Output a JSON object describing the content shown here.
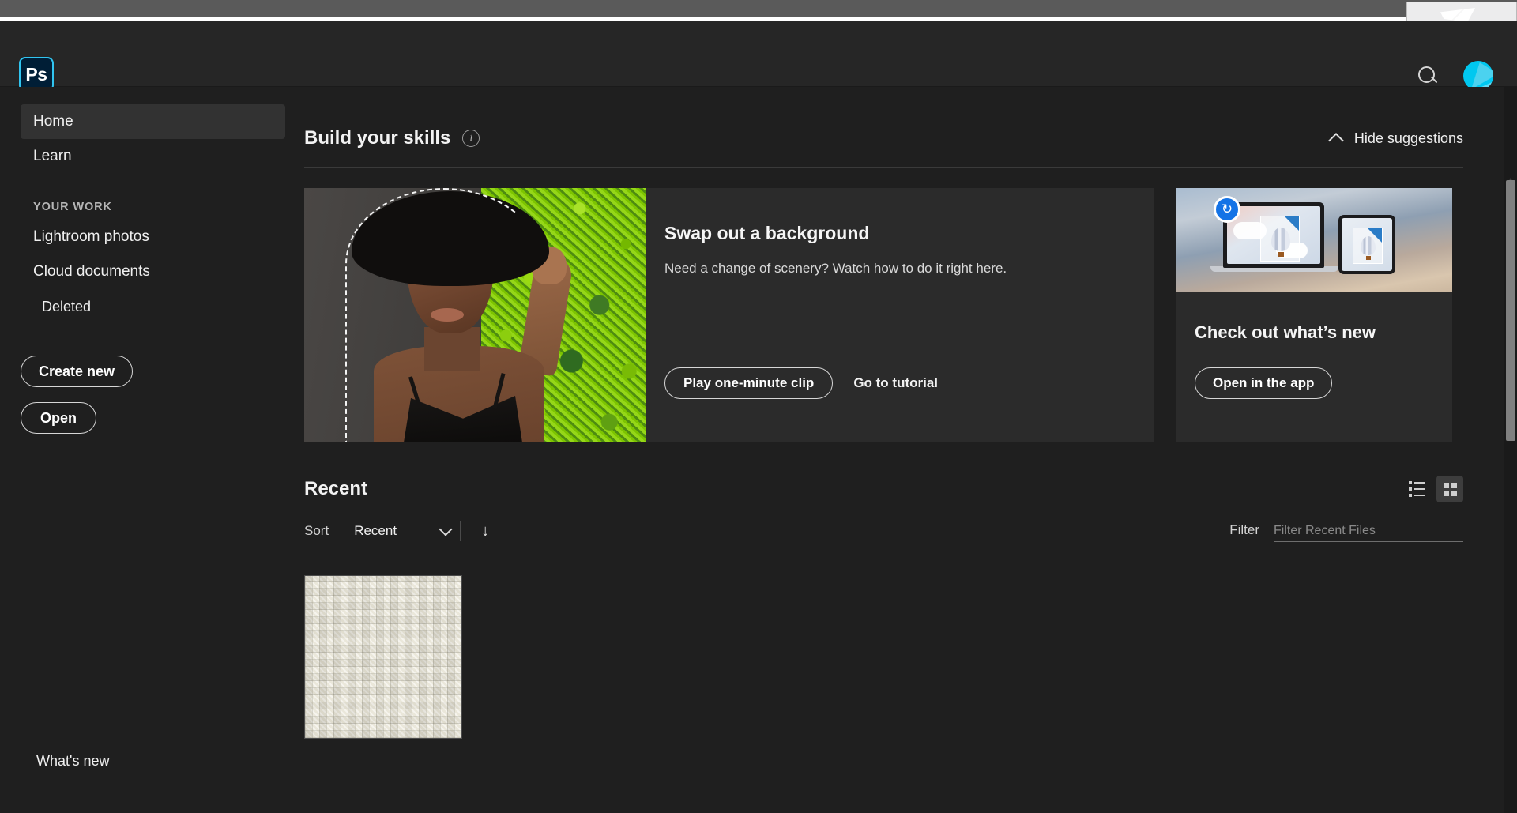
{
  "window": {
    "title_bar_tab": ""
  },
  "appbar": {
    "logo_text": "Ps",
    "search_icon": "search-icon",
    "avatar_icon": "user-avatar"
  },
  "sidebar": {
    "items": [
      {
        "label": "Home",
        "active": true
      },
      {
        "label": "Learn",
        "active": false
      }
    ],
    "group_title": "YOUR WORK",
    "work_items": [
      {
        "label": "Lightroom photos",
        "sub": false
      },
      {
        "label": "Cloud documents",
        "sub": false
      },
      {
        "label": "Deleted",
        "sub": true
      }
    ],
    "create_new_label": "Create new",
    "open_label": "Open",
    "whats_new_label": "What's new"
  },
  "skills": {
    "title": "Build your skills",
    "info_icon": "info-icon",
    "hide_label": "Hide suggestions",
    "chevron_icon": "chevron-up-icon"
  },
  "tutorial_card": {
    "title": "Swap out a background",
    "description": "Need a change of scenery? Watch how to do it right here.",
    "play_label": "Play one-minute clip",
    "link_label": "Go to tutorial",
    "thumbnail_alt": "woman-with-hat-selection"
  },
  "whatsnew_card": {
    "title": "Check out what’s new",
    "button_label": "Open in the app",
    "illustration_alt": "laptop-and-tablet-cloud-sync",
    "badge_icon": "sync-icon"
  },
  "recent": {
    "title": "Recent",
    "sort_label": "Sort",
    "sort_value": "Recent",
    "sort_direction_icon": "arrow-down-icon",
    "chevron_icon": "chevron-down-icon",
    "filter_label": "Filter",
    "filter_placeholder": "Filter Recent Files",
    "filter_value": "",
    "view_list_icon": "list-view-icon",
    "view_grid_icon": "grid-view-icon",
    "active_view": "grid",
    "files": [
      {
        "name": "",
        "thumbnail_alt": "basketweave-texture"
      }
    ]
  },
  "colors": {
    "accent": "#31c5f0",
    "avatar": "#00c8f0",
    "app_bg": "#1f1f1f",
    "card_bg": "#2b2b2b",
    "appbar_bg": "#262626",
    "titlebar_bg": "#5a5a5a",
    "badge_blue": "#1473e6"
  }
}
